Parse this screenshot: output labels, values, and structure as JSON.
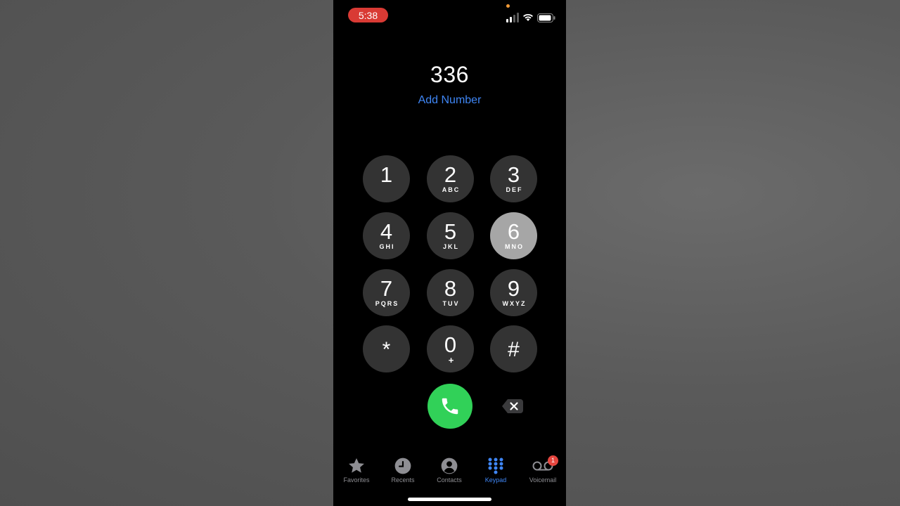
{
  "status_bar": {
    "time": "5:38",
    "icons": [
      "signal-icon",
      "wifi-icon",
      "battery-icon"
    ]
  },
  "dialer": {
    "number": "336",
    "add_number_label": "Add Number"
  },
  "keypad": {
    "keys": [
      {
        "digit": "1",
        "letters": ""
      },
      {
        "digit": "2",
        "letters": "ABC"
      },
      {
        "digit": "3",
        "letters": "DEF"
      },
      {
        "digit": "4",
        "letters": "GHI"
      },
      {
        "digit": "5",
        "letters": "JKL"
      },
      {
        "digit": "6",
        "letters": "MNO"
      },
      {
        "digit": "7",
        "letters": "PQRS"
      },
      {
        "digit": "8",
        "letters": "TUV"
      },
      {
        "digit": "9",
        "letters": "WXYZ"
      },
      {
        "digit": "*",
        "letters": ""
      },
      {
        "digit": "0",
        "letters": "+"
      },
      {
        "digit": "#",
        "letters": ""
      }
    ],
    "pressed_key": "6"
  },
  "tab_bar": {
    "tabs": [
      {
        "label": "Favorites",
        "icon": "star-icon"
      },
      {
        "label": "Recents",
        "icon": "clock-icon"
      },
      {
        "label": "Contacts",
        "icon": "person-icon"
      },
      {
        "label": "Keypad",
        "icon": "keypad-icon"
      },
      {
        "label": "Voicemail",
        "icon": "voicemail-icon"
      }
    ],
    "active_tab": "Keypad",
    "voicemail_badge": "1"
  },
  "colors": {
    "accent": "#3f86f5",
    "call_green": "#31d158",
    "recording_red": "#d93a34",
    "badge_red": "#e5463f",
    "key_gray": "#333333",
    "key_pressed": "#a6a6a6"
  }
}
